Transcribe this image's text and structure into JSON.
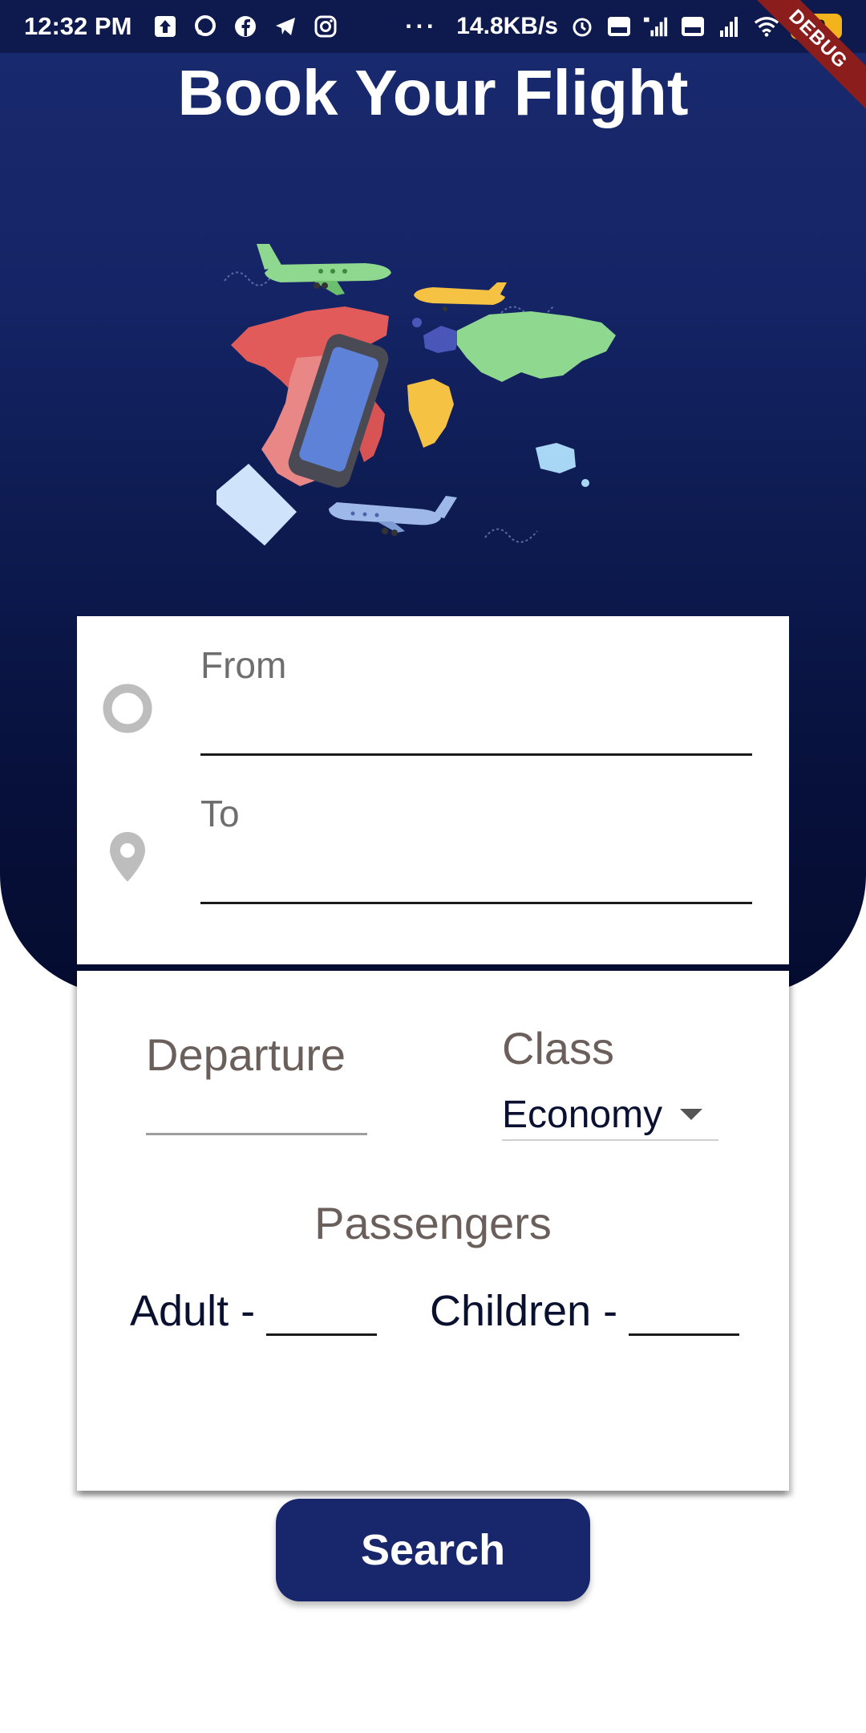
{
  "status_bar": {
    "time": "12:32 PM",
    "net_speed": "14.8KB/s",
    "more": "···",
    "battery": "90",
    "icons": [
      "upload-icon",
      "chat-bubble-icon",
      "facebook-icon",
      "telegram-icon",
      "instagram-icon",
      "alarm-icon",
      "volte-icon",
      "signal-4g-icon",
      "volte-icon",
      "signal-icon",
      "wifi-icon",
      "battery-icon"
    ]
  },
  "debug_banner": "DEBUG",
  "page": {
    "title": "Book Your Flight"
  },
  "route": {
    "from_label": "From",
    "from_value": "",
    "to_label": "To",
    "to_value": ""
  },
  "details": {
    "departure_label": "Departure",
    "class_label": "Class",
    "class_value": "Economy",
    "passengers_label": "Passengers",
    "adult_label": "Adult -",
    "adult_value": "",
    "children_label": "Children -",
    "children_value": ""
  },
  "search_button": "Search",
  "colors": {
    "hero_top": "#1a2a6f",
    "hero_bottom": "#050c30",
    "button": "#18266b",
    "label_muted": "#6b5f5c",
    "text_dark": "#0a1030"
  }
}
